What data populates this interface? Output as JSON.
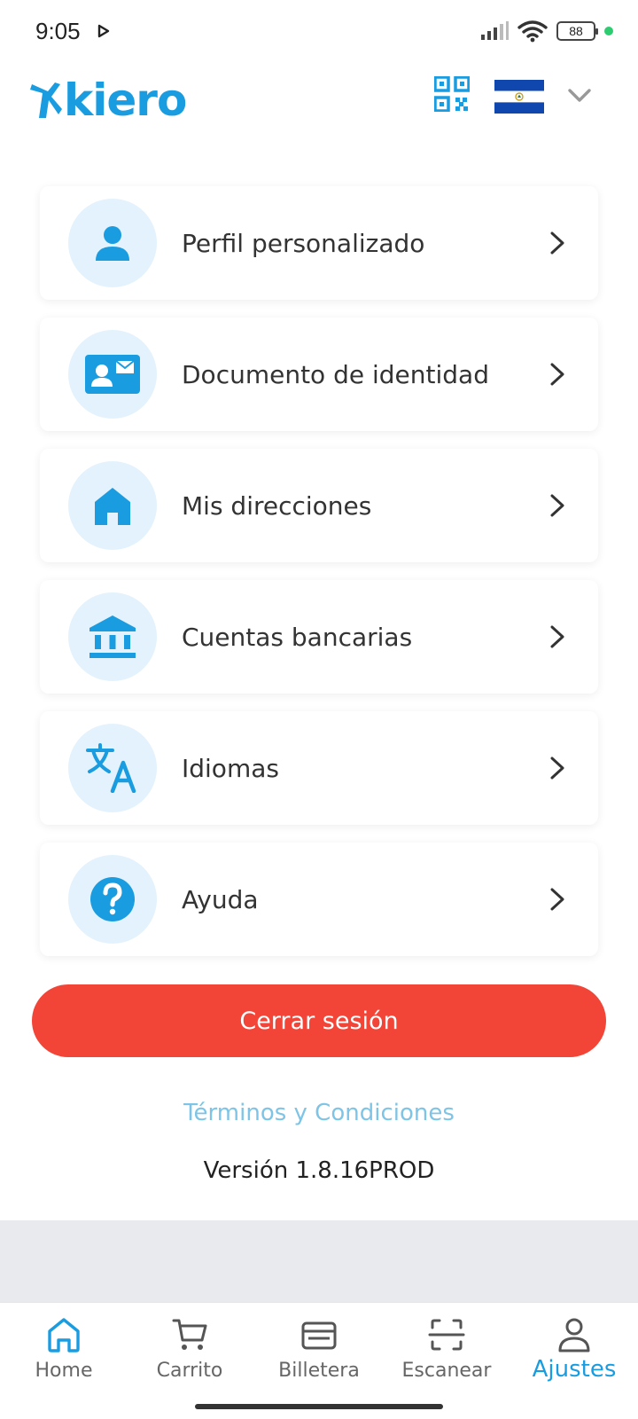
{
  "status": {
    "time": "9:05",
    "battery": "88",
    "dot_color": "#2ecc71"
  },
  "header": {
    "logo_text": "kiero",
    "logo_color": "#1a9ce0",
    "qr_icon": "qr-code-icon",
    "flag_icon": "el-salvador-flag-icon",
    "dropdown_icon": "chevron-down-icon"
  },
  "menu": [
    {
      "label": "Perfil personalizado",
      "icon": "person-icon"
    },
    {
      "label": "Documento de identidad",
      "icon": "id-card-icon"
    },
    {
      "label": "Mis direcciones",
      "icon": "home-icon"
    },
    {
      "label": "Cuentas bancarias",
      "icon": "bank-icon"
    },
    {
      "label": "Idiomas",
      "icon": "translate-icon"
    },
    {
      "label": "Ayuda",
      "icon": "help-icon"
    }
  ],
  "logout": {
    "label": "Cerrar sesión",
    "color": "#f24437"
  },
  "terms": {
    "label": "Términos y Condiciones"
  },
  "version": {
    "label": "Versión 1.8.16PROD"
  },
  "nav": {
    "items": [
      {
        "label": "Home",
        "icon": "home-icon",
        "active": false
      },
      {
        "label": "Carrito",
        "icon": "cart-icon",
        "active": false
      },
      {
        "label": "Billetera",
        "icon": "wallet-icon",
        "active": false
      },
      {
        "label": "Escanear",
        "icon": "scan-icon",
        "active": false
      },
      {
        "label": "Ajustes",
        "icon": "user-icon",
        "active": true
      }
    ],
    "active_color": "#1a9ce0"
  },
  "accent_color": "#1a9ce0"
}
